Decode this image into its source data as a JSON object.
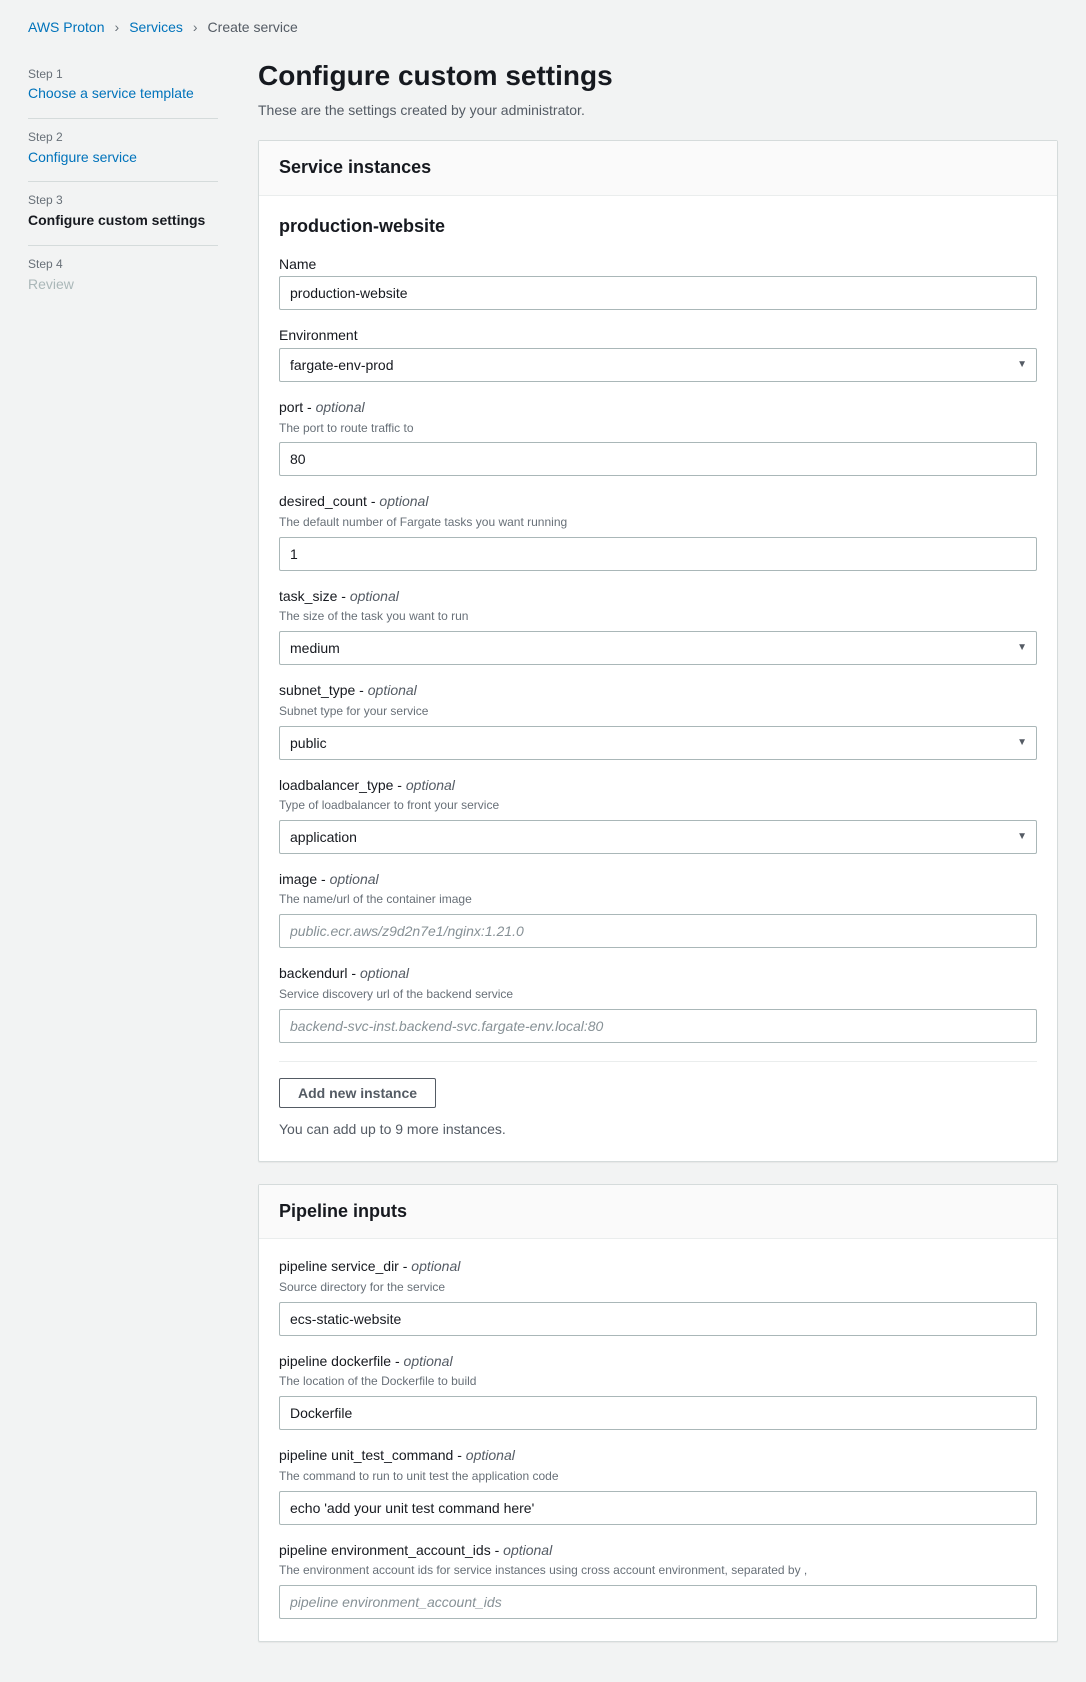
{
  "breadcrumb": {
    "items": [
      {
        "label": "AWS Proton",
        "link": true
      },
      {
        "label": "Services",
        "link": true
      },
      {
        "label": "Create service",
        "link": false
      }
    ]
  },
  "sidebar": {
    "steps": [
      {
        "num": "Step 1",
        "title": "Choose a service template",
        "state": "link"
      },
      {
        "num": "Step 2",
        "title": "Configure service",
        "state": "link"
      },
      {
        "num": "Step 3",
        "title": "Configure custom settings",
        "state": "active"
      },
      {
        "num": "Step 4",
        "title": "Review",
        "state": "disabled"
      }
    ]
  },
  "header": {
    "title": "Configure custom settings",
    "subtitle": "These are the settings created by your administrator."
  },
  "service_instances": {
    "panel_title": "Service instances",
    "instance_title": "production-website",
    "fields": {
      "name": {
        "label": "Name",
        "value": "production-website"
      },
      "environment": {
        "label": "Environment",
        "value": "fargate-env-prod"
      },
      "port": {
        "label": "port",
        "optional": "optional",
        "hint": "The port to route traffic to",
        "value": "80"
      },
      "desired_count": {
        "label": "desired_count",
        "optional": "optional",
        "hint": "The default number of Fargate tasks you want running",
        "value": "1"
      },
      "task_size": {
        "label": "task_size",
        "optional": "optional",
        "hint": "The size of the task you want to run",
        "value": "medium"
      },
      "subnet_type": {
        "label": "subnet_type",
        "optional": "optional",
        "hint": "Subnet type for your service",
        "value": "public"
      },
      "loadbalancer_type": {
        "label": "loadbalancer_type",
        "optional": "optional",
        "hint": "Type of loadbalancer to front your service",
        "value": "application"
      },
      "image": {
        "label": "image",
        "optional": "optional",
        "hint": "The name/url of the container image",
        "placeholder": "public.ecr.aws/z9d2n7e1/nginx:1.21.0"
      },
      "backendurl": {
        "label": "backendurl",
        "optional": "optional",
        "hint": "Service discovery url of the backend service",
        "placeholder": "backend-svc-inst.backend-svc.fargate-env.local:80"
      }
    },
    "add_button": "Add new instance",
    "add_note": "You can add up to 9 more instances."
  },
  "pipeline_inputs": {
    "panel_title": "Pipeline inputs",
    "fields": {
      "service_dir": {
        "label": "pipeline service_dir",
        "optional": "optional",
        "hint": "Source directory for the service",
        "value": "ecs-static-website"
      },
      "dockerfile": {
        "label": "pipeline dockerfile",
        "optional": "optional",
        "hint": "The location of the Dockerfile to build",
        "value": "Dockerfile"
      },
      "unit_test_command": {
        "label": "pipeline unit_test_command",
        "optional": "optional",
        "hint": "The command to run to unit test the application code",
        "value": "echo 'add your unit test command here'"
      },
      "environment_account_ids": {
        "label": "pipeline environment_account_ids",
        "optional": "optional",
        "hint": "The environment account ids for service instances using cross account environment, separated by ,",
        "placeholder": "pipeline environment_account_ids"
      }
    }
  },
  "optional_sep": " - "
}
